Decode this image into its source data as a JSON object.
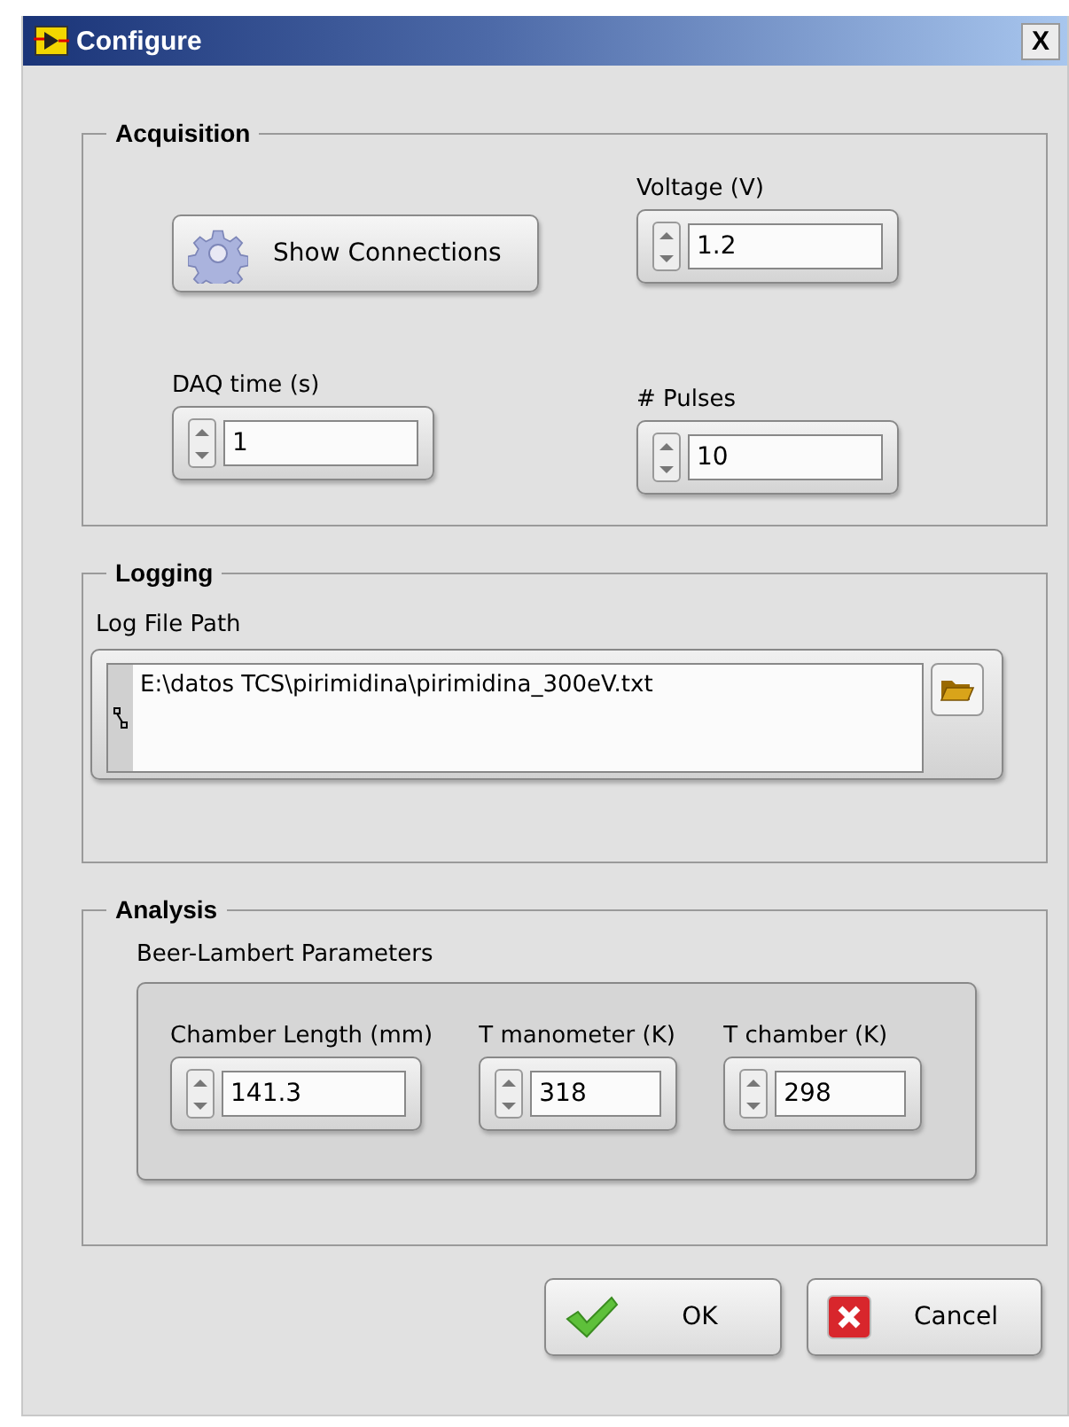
{
  "window": {
    "title": "Configure",
    "close": "X"
  },
  "acquisition": {
    "title": "Acquisition",
    "show_connections": "Show Connections",
    "controls": [
      {
        "label": "Voltage (V)",
        "value": "1.2"
      },
      {
        "label": "DAQ time (s)",
        "value": "1"
      },
      {
        "label": "# Pulses",
        "value": "10"
      }
    ]
  },
  "logging": {
    "title": "Logging",
    "path_label": "Log File Path",
    "path": "E:\\datos TCS\\pirimidina\\pirimidina_300eV.txt"
  },
  "analysis": {
    "title": "Analysis",
    "cluster_label": "Beer-Lambert Parameters",
    "controls": [
      {
        "label": "Chamber Length (mm)",
        "value": "141.3"
      },
      {
        "label": "T manometer (K)",
        "value": "318"
      },
      {
        "label": "T chamber (K)",
        "value": "298"
      }
    ]
  },
  "buttons": [
    {
      "kind": "ok",
      "label": "OK"
    },
    {
      "kind": "cancel",
      "label": "Cancel"
    }
  ]
}
